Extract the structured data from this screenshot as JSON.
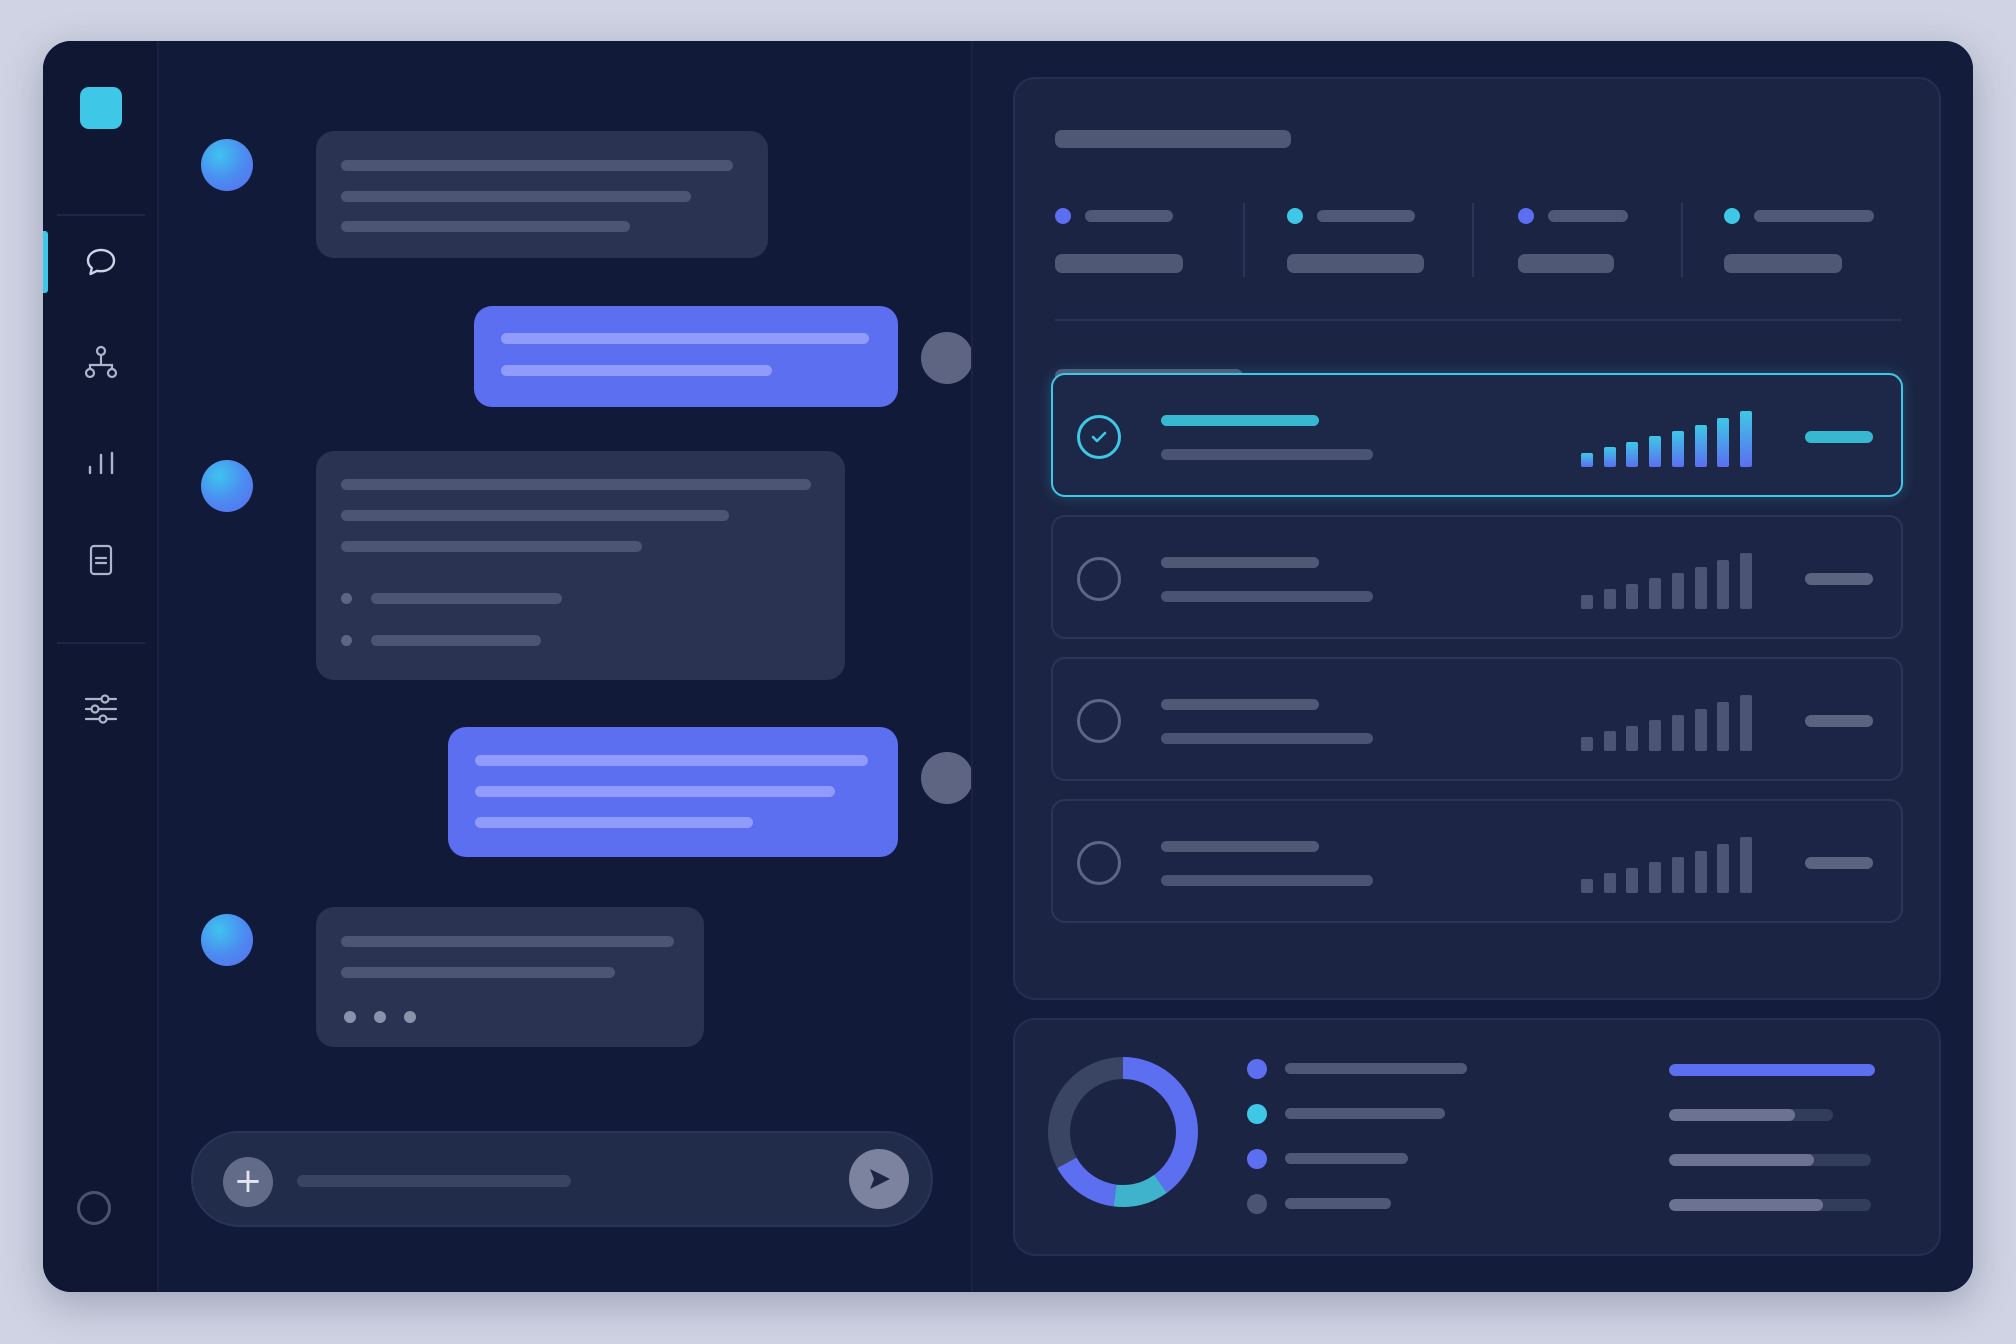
{
  "theme": {
    "accent_cyan": "#3ec7e6",
    "accent_blue": "#5b6ff0",
    "background": "#111a38",
    "surface": "#1b2443"
  },
  "sidebar": {
    "logo": "app-logo",
    "items": [
      {
        "icon": "chat-bubble-icon",
        "active": true
      },
      {
        "icon": "hierarchy-icon",
        "active": false
      },
      {
        "icon": "bar-chart-icon",
        "active": false
      },
      {
        "icon": "document-icon",
        "active": false
      },
      {
        "icon": "sliders-icon",
        "active": false
      }
    ],
    "footer_icon": "user-circle-icon"
  },
  "chat": {
    "messages": [
      {
        "role": "assistant",
        "content": "placeholder-lines"
      },
      {
        "role": "user",
        "content": "placeholder-lines"
      },
      {
        "role": "assistant",
        "content": "placeholder-lines-with-list"
      },
      {
        "role": "user",
        "content": "placeholder-lines"
      },
      {
        "role": "assistant",
        "content": "typing"
      }
    ],
    "composer": {
      "attach_icon": "plus-icon",
      "send_icon": "send-icon"
    }
  },
  "panel": {
    "stats": [
      {
        "color": "#5b6ff0"
      },
      {
        "color": "#3ec7e6"
      },
      {
        "color": "#5b6ff0"
      },
      {
        "color": "#3ec7e6"
      }
    ],
    "options": [
      {
        "selected": true,
        "trend": [
          0.25,
          0.35,
          0.45,
          0.55,
          0.65,
          0.75,
          0.87,
          1.0
        ]
      },
      {
        "selected": false,
        "trend": [
          0.25,
          0.35,
          0.45,
          0.55,
          0.65,
          0.75,
          0.87,
          1.0
        ]
      },
      {
        "selected": false,
        "trend": [
          0.25,
          0.35,
          0.45,
          0.55,
          0.65,
          0.75,
          0.87,
          1.0
        ]
      },
      {
        "selected": false,
        "trend": [
          0.25,
          0.35,
          0.45,
          0.55,
          0.65,
          0.75,
          0.87,
          1.0
        ]
      }
    ],
    "breakdown": {
      "donut_segments": [
        {
          "color": "#5b6ff0",
          "share": 0.4
        },
        {
          "color": "#3fb3cc",
          "share": 0.12
        },
        {
          "color": "#5b6ff0",
          "share": 0.15
        },
        {
          "color": "#3a4463",
          "share": 0.33
        }
      ],
      "legend_colors": [
        "#5b6ff0",
        "#3ec7e6",
        "#5b6ff0",
        "#4b5472"
      ],
      "progress": [
        {
          "value": 1.0,
          "color": "#5b6ff0"
        },
        {
          "value": 0.77,
          "color": "#6b7390"
        },
        {
          "value": 0.72,
          "color": "#6b7390"
        },
        {
          "value": 0.76,
          "color": "#6b7390"
        }
      ]
    }
  }
}
